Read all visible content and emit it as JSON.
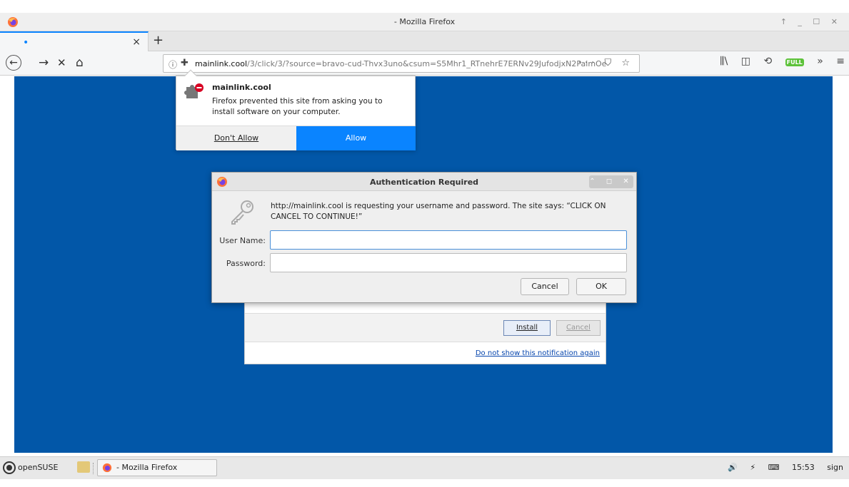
{
  "window": {
    "title": "- Mozilla Firefox",
    "controls": "↑ _ ☐ ✕"
  },
  "tab": {
    "title": "•",
    "close": "×",
    "new_tab": "+"
  },
  "nav": {
    "back": "←",
    "forward": "→",
    "stop": "✕",
    "home": "⌂",
    "url_host": "mainlink.cool",
    "url_path": "/3/click/3/?source=bravo-cud-Thvx3uno&csum=S5Mhr1_RTnehrE7ERNv29JufodjxN2PaimOe",
    "page_actions": "··· ⛉ ☆",
    "library": "⫼\\",
    "sidebar": "◫",
    "history": "⟲",
    "fullpage_badge": "FULL",
    "overflow": "»",
    "menu": "≡"
  },
  "doorhanger": {
    "title": "mainlink.cool",
    "message": "Firefox prevented this site from asking you to install software on your computer.",
    "dont_allow": "Don't Allow",
    "allow": "Allow"
  },
  "auth": {
    "title": "Authentication Required",
    "controls": "⌃ ◻ ✕",
    "message": "http://mainlink.cool is requesting your username and password. The site says: “CLICK ON CANCEL TO CONTINUE!”",
    "username_label": "User Name:",
    "password_label": "Password:",
    "username_value": "",
    "password_value": "",
    "cancel": "Cancel",
    "ok": "OK"
  },
  "install_panel": {
    "install": "Install",
    "cancel": "Cancel",
    "dont_show": "Do not show this notification again"
  },
  "taskbar": {
    "start": "openSUSE",
    "task": "- Mozilla Firefox",
    "volume": "🔊",
    "battery": "⚡",
    "keyboard": "⌨",
    "clock": "15:53",
    "user": "sign"
  },
  "colors": {
    "page_bg": "#0257a8",
    "accent": "#0a84ff"
  }
}
